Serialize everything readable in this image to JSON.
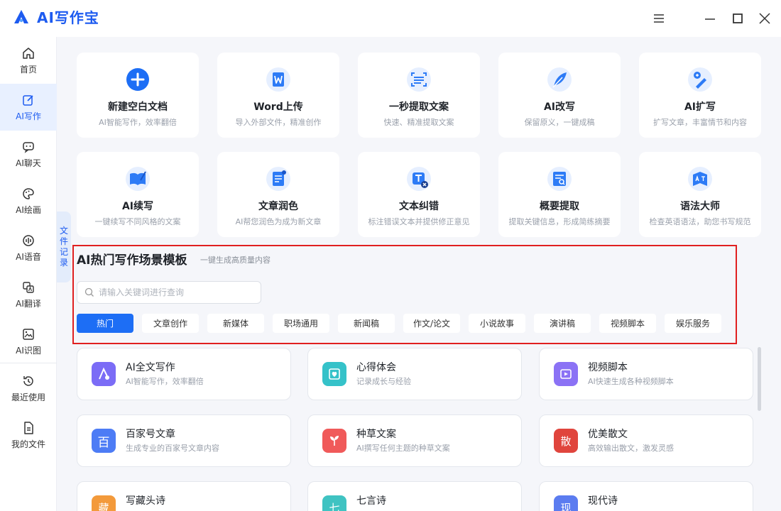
{
  "app": {
    "title": "AI写作宝"
  },
  "sidebar": {
    "items": [
      {
        "label": "首页",
        "icon": "home-icon"
      },
      {
        "label": "AI写作",
        "icon": "edit-icon"
      },
      {
        "label": "AI聊天",
        "icon": "chat-icon"
      },
      {
        "label": "AI绘画",
        "icon": "palette-icon"
      },
      {
        "label": "AI语音",
        "icon": "voice-icon"
      },
      {
        "label": "AI翻译",
        "icon": "translate-icon"
      },
      {
        "label": "AI识图",
        "icon": "image-icon"
      },
      {
        "label": "最近使用",
        "icon": "history-icon"
      },
      {
        "label": "我的文件",
        "icon": "file-icon"
      }
    ],
    "active": "AI写作"
  },
  "history_tab": {
    "chars": [
      "文",
      "件",
      "记",
      "录"
    ]
  },
  "tools": [
    {
      "title": "新建空白文档",
      "desc": "AI智能写作，效率翻倍",
      "icon": "plus-icon"
    },
    {
      "title": "Word上传",
      "desc": "导入外部文件，精准创作",
      "icon": "word-icon"
    },
    {
      "title": "一秒提取文案",
      "desc": "快速、精准提取文案",
      "icon": "scan-icon"
    },
    {
      "title": "AI改写",
      "desc": "保留原义，一键成稿",
      "icon": "feather-icon"
    },
    {
      "title": "AI扩写",
      "desc": "扩写文章，丰富情节和内容",
      "icon": "expand-icon"
    },
    {
      "title": "AI续写",
      "desc": "一键续写不同风格的文案",
      "icon": "continue-icon"
    },
    {
      "title": "文章润色",
      "desc": "AI帮您润色为成为新文章",
      "icon": "polish-icon"
    },
    {
      "title": "文本纠错",
      "desc": "标注错误文本并提供修正意见",
      "icon": "correct-icon"
    },
    {
      "title": "概要提取",
      "desc": "提取关键信息，形成简练摘要",
      "icon": "summary-icon"
    },
    {
      "title": "语法大师",
      "desc": "检查英语语法，助您书写规范",
      "icon": "grammar-icon"
    }
  ],
  "templates_section": {
    "title": "AI热门写作场景模板",
    "subtitle": "一键生成高质量内容",
    "search_placeholder": "请输入关键词进行查询",
    "categories": [
      "热门",
      "文章创作",
      "新媒体",
      "职场通用",
      "新闻稿",
      "作文/论文",
      "小说故事",
      "演讲稿",
      "视频脚本",
      "娱乐服务"
    ],
    "active_category": "热门"
  },
  "templates": [
    {
      "title": "AI全文写作",
      "desc": "AI智能写作，效率翻倍",
      "icon": "ai-write-icon",
      "color": "#7b6cf6"
    },
    {
      "title": "心得体会",
      "desc": "记录成长与经验",
      "icon": "notebook-icon",
      "color": "#35c2c9"
    },
    {
      "title": "视频脚本",
      "desc": "AI快速生成各种视频脚本",
      "icon": "video-icon",
      "color": "#8b72f5"
    },
    {
      "title": "百家号文章",
      "desc": "生成专业的百家号文章内容",
      "icon": "baijia-icon",
      "color": "#4d7cf5",
      "glyph": "百"
    },
    {
      "title": "种草文案",
      "desc": "AI撰写任何主题的种草文案",
      "icon": "leaf-icon",
      "color": "#f05a5a"
    },
    {
      "title": "优美散文",
      "desc": "高效输出散文，激发灵感",
      "icon": "prose-icon",
      "color": "#e0453d",
      "glyph": "散"
    },
    {
      "title": "写藏头诗",
      "desc": "",
      "icon": "poem-icon",
      "color": "#f39a3b",
      "glyph": "藏"
    },
    {
      "title": "七言诗",
      "desc": "",
      "icon": "seven-icon",
      "color": "#3fc3c2",
      "glyph": "七"
    },
    {
      "title": "现代诗",
      "desc": "",
      "icon": "modern-icon",
      "color": "#5b7cf0",
      "glyph": "现"
    }
  ]
}
